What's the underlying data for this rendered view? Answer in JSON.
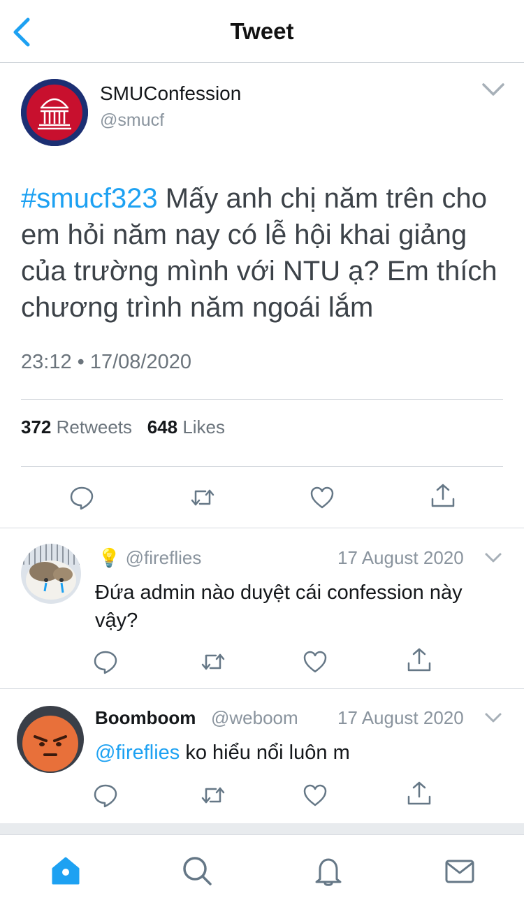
{
  "header": {
    "title": "Tweet",
    "back_icon": "back-chevron-icon"
  },
  "main_tweet": {
    "name": "SMUConfession",
    "handle": "@smucf",
    "hashtag": "#smucf323",
    "text": " Mấy anh chị năm trên cho em hỏi năm nay có lễ hội khai giảng của trường mình với NTU ạ? Em thích chương trình năm ngoái lắm",
    "timestamp": "23:12 • 17/08/2020",
    "retweets_count": "372",
    "retweets_label": "Retweets",
    "likes_count": "648",
    "likes_label": "Likes"
  },
  "replies": [
    {
      "emoji": "💡",
      "name": "",
      "handle": "@fireflies",
      "date": "17 August 2020",
      "mention": "",
      "text": "Đứa admin nào duyệt cái confession này vậy?"
    },
    {
      "name": "Boomboom",
      "handle": "@weboom",
      "date": "17 August 2020",
      "mention": "@fireflies",
      "text": " ko hiểu nổi luôn m"
    }
  ],
  "tabs": [
    "home-icon",
    "search-icon",
    "notifications-icon",
    "messages-icon"
  ],
  "colors": {
    "accent": "#1da1f2",
    "text": "#14171a",
    "muted": "#8a949e",
    "logo_bg": "#1c2f73",
    "logo_red": "#c8102e"
  }
}
